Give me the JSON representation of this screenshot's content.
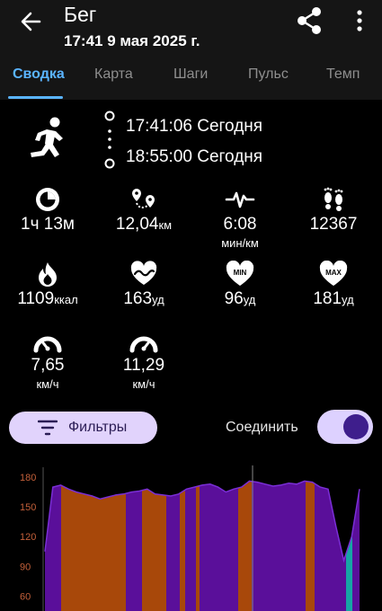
{
  "header": {
    "title": "Бег",
    "subtitle": "17:41 9 мая 2025 г."
  },
  "tabs": [
    {
      "label": "Сводка",
      "active": true
    },
    {
      "label": "Карта"
    },
    {
      "label": "Шаги"
    },
    {
      "label": "Пульс"
    },
    {
      "label": "Темп"
    }
  ],
  "activity": {
    "icon": "running-person-icon",
    "start": "17:41:06 Сегодня",
    "end": "18:55:00 Сегодня"
  },
  "stats": {
    "duration": {
      "value": "1ч 13м",
      "icon": "timer-icon"
    },
    "distance": {
      "value": "12,04",
      "unit": "км",
      "icon": "route-icon"
    },
    "pace": {
      "value": "6:08",
      "unit": "мин/км",
      "icon": "pace-icon"
    },
    "steps": {
      "value": "12367",
      "icon": "footprints-icon"
    },
    "calories": {
      "value": "1109",
      "unit": "ккал",
      "icon": "flame-icon"
    },
    "avg_hr": {
      "value": "163",
      "unit": "уд",
      "icon": "heart-wave-icon"
    },
    "min_hr": {
      "value": "96",
      "unit": "уд",
      "icon": "heart-min-icon",
      "badge": "MIN"
    },
    "max_hr": {
      "value": "181",
      "unit": "уд",
      "icon": "heart-max-icon",
      "badge": "MAX"
    },
    "avg_speed": {
      "value": "7,65",
      "unit": "км/ч",
      "icon": "speedometer-icon"
    },
    "max_speed": {
      "value": "11,29",
      "unit": "км/ч",
      "icon": "speedometer-max-icon"
    }
  },
  "controls": {
    "filters_label": "Фильтры",
    "join_label": "Соединить",
    "join_enabled": true
  },
  "colors": {
    "accent": "#5ab4ff",
    "zone_orange": "#a8480a",
    "zone_purple": "#5a0f9a",
    "zone_teal": "#17a5a5",
    "hr_line": "#7a2ed6"
  },
  "chart_data": {
    "type": "area",
    "ylabel": "",
    "ylim": [
      45,
      190
    ],
    "yticks": [
      "180",
      "150",
      "120",
      "90",
      "60"
    ],
    "y": [
      105,
      170,
      172,
      168,
      165,
      163,
      161,
      158,
      160,
      162,
      163,
      165,
      166,
      168,
      163,
      162,
      161,
      163,
      168,
      170,
      172,
      173,
      170,
      165,
      168,
      170,
      176,
      175,
      173,
      171,
      172,
      174,
      173,
      176,
      175,
      170,
      168,
      130,
      96,
      120,
      168
    ]
  }
}
